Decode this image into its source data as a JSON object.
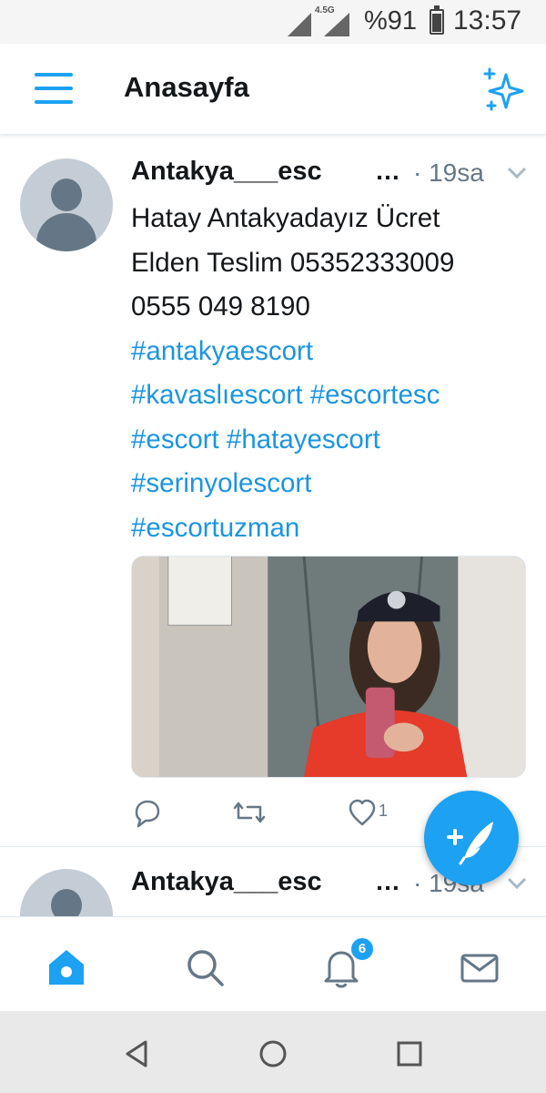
{
  "status_bar": {
    "network_label": "4.5G",
    "battery_percent": "%91",
    "battery_level": 0.91,
    "time": "13:57"
  },
  "header": {
    "title": "Anasayfa",
    "menu_icon": "hamburger-menu-icon",
    "action_icon": "sparkle-icon"
  },
  "tweets": [
    {
      "author": "Antakya___esc",
      "ellipsis": "…",
      "time": "· 19sa",
      "text_lines": [
        "Hatay Antakyadayız Ücret",
        "Elden Teslim 05352333009",
        "0555 049 8190"
      ],
      "hashtag_lines": [
        "#antakyaescort",
        "#kavaslıescort #escortesc",
        "#escort #hatayescort",
        "#serinyolescort",
        "#escortuzman"
      ],
      "like_count": "1"
    },
    {
      "author": "Antakya___esc",
      "ellipsis": "…",
      "time": "· 19sa"
    }
  ],
  "tab_bar": {
    "tabs": [
      "home-icon",
      "search-icon",
      "notifications-icon",
      "messages-icon"
    ],
    "notification_badge": "6"
  },
  "colors": {
    "accent": "#1da1f2",
    "link": "#1b95e0",
    "muted": "#657786",
    "text": "#14171a"
  }
}
